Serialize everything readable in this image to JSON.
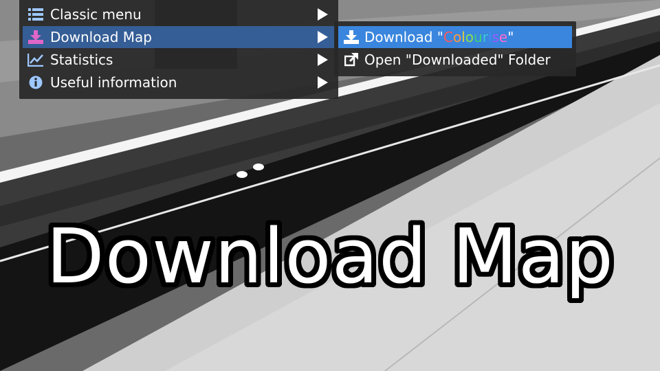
{
  "main_menu": {
    "items": [
      {
        "label": "Classic menu",
        "icon": "list-icon",
        "active": false
      },
      {
        "label": "Download Map",
        "icon": "download-icon",
        "active": true
      },
      {
        "label": "Statistics",
        "icon": "chart-line-icon",
        "active": false
      },
      {
        "label": "Useful information",
        "icon": "info-icon",
        "active": false
      }
    ]
  },
  "submenu": {
    "items": [
      {
        "label_prefix": "Download \"",
        "map_name_letters": [
          "C",
          "o",
          "l",
          "o",
          "u",
          "r",
          "i",
          "s",
          "e"
        ],
        "label_suffix": "\"",
        "icon": "download-icon",
        "active": true
      },
      {
        "label": "Open \"Downloaded\" Folder",
        "icon": "external-link-icon",
        "active": false
      }
    ]
  },
  "colors": {
    "menu_active": "#355e96",
    "submenu_active": "#3a86de",
    "download_icon": "#e066c8",
    "map_name_rainbow": [
      "#ff5a5a",
      "#ff9a3a",
      "#e0d23a",
      "#8ee04a",
      "#3ad07a",
      "#3ac8d8",
      "#4a8aff",
      "#9a5aff",
      "#ff6ad0"
    ]
  },
  "overlay": {
    "title": "Download Map"
  }
}
